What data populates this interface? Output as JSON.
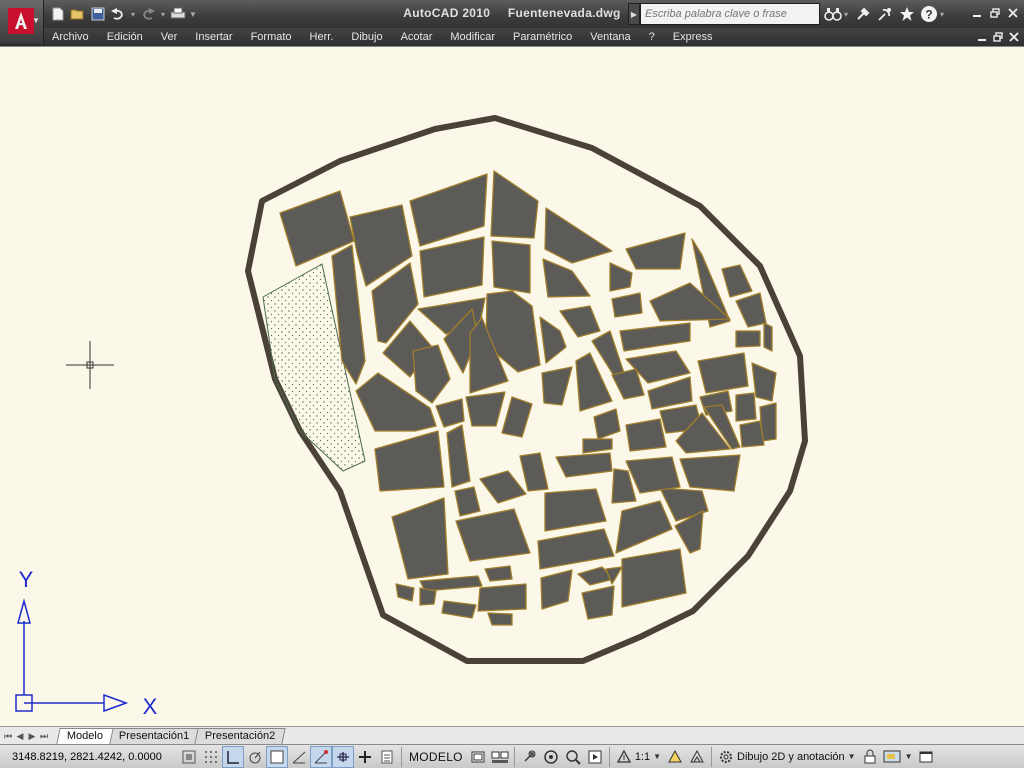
{
  "window": {
    "app_name": "AutoCAD 2010",
    "file_name": "Fuentenevada.dwg"
  },
  "search": {
    "placeholder": "Escriba palabra clave o frase"
  },
  "menu": {
    "items": [
      "Archivo",
      "Edición",
      "Ver",
      "Insertar",
      "Formato",
      "Herr.",
      "Dibujo",
      "Acotar",
      "Modificar",
      "Paramétrico",
      "Ventana",
      "?",
      "Express"
    ]
  },
  "ucs": {
    "x_label": "X",
    "y_label": "Y"
  },
  "tabs": {
    "items": [
      "Modelo",
      "Presentación1",
      "Presentación2"
    ],
    "active": "Modelo"
  },
  "status": {
    "coordinates": "3148.8219, 2821.4242, 0.0000",
    "space": "MODELO",
    "annotation_scale": "1:1",
    "workspace": "Dibujo 2D y anotación"
  },
  "colors": {
    "canvas": "#fbf8ea",
    "block_fill": "#5d5b58",
    "block_outline": "#a07e2a",
    "boundary": "#4b4237",
    "ucs_icon": "#1f2bd0",
    "title_bar": "#3c3c3c",
    "app_logo": "#c8102e"
  },
  "icons": {
    "app": "autocad-logo-icon",
    "qat": [
      "new-icon",
      "open-icon",
      "save-icon",
      "undo-icon",
      "redo-icon",
      "plot-icon",
      "qat-dropdown-icon"
    ],
    "search_tools": [
      "binoculars-icon",
      "subscription-icon",
      "communication-icon",
      "favorites-icon",
      "help-icon"
    ],
    "window": [
      "minimize-icon",
      "restore-icon",
      "close-icon"
    ]
  }
}
